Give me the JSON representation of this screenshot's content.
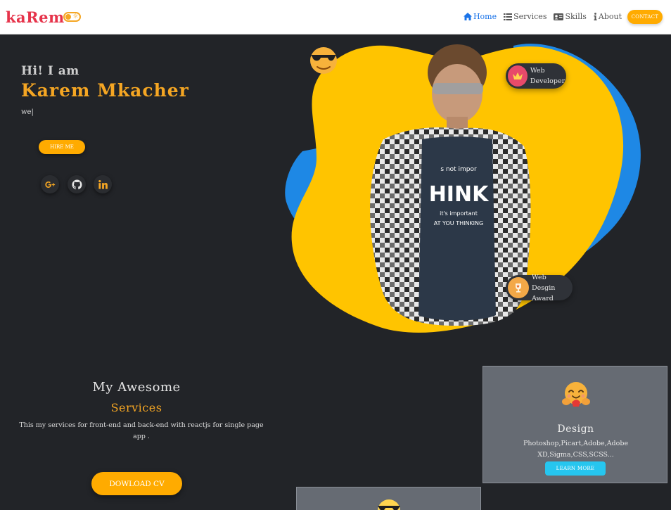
{
  "brand": {
    "logo": "kaRem",
    "accent": "#f5a623",
    "logo_color": "#e6334a"
  },
  "nav": {
    "items": [
      {
        "label": "Home",
        "icon": "home-icon",
        "active": true
      },
      {
        "label": "Services",
        "icon": "list-icon",
        "active": false
      },
      {
        "label": "Skills",
        "icon": "id-card-icon",
        "active": false
      },
      {
        "label": "About",
        "icon": "info-icon",
        "active": false
      }
    ],
    "contact": "CONTACT"
  },
  "hero": {
    "greeting": "Hi! I am",
    "name": "Karem Mkacher",
    "typed": "we|",
    "hire": "HIRE ME",
    "socials": [
      "google-plus-icon",
      "github-icon",
      "linkedin-icon"
    ],
    "badges": [
      {
        "text": "Web Developer",
        "icon": "crown-icon"
      },
      {
        "text": "Web Desgin Award",
        "icon": "trophy-icon"
      }
    ]
  },
  "services": {
    "title": "My Awesome",
    "subtitle": "Services",
    "description": "This my services for front-end and back-end with reactjs for single page app .",
    "cv_button": "DOWLOAD CV",
    "cards": [
      {
        "title": "Design",
        "description": "Photoshop,Picart,Adobe,Adobe XD,Sigma,CSS,SCSS...",
        "button": "LEARN MORE",
        "icon": "hugging-face-icon"
      },
      {
        "icon": "cool-face-icon"
      }
    ]
  }
}
